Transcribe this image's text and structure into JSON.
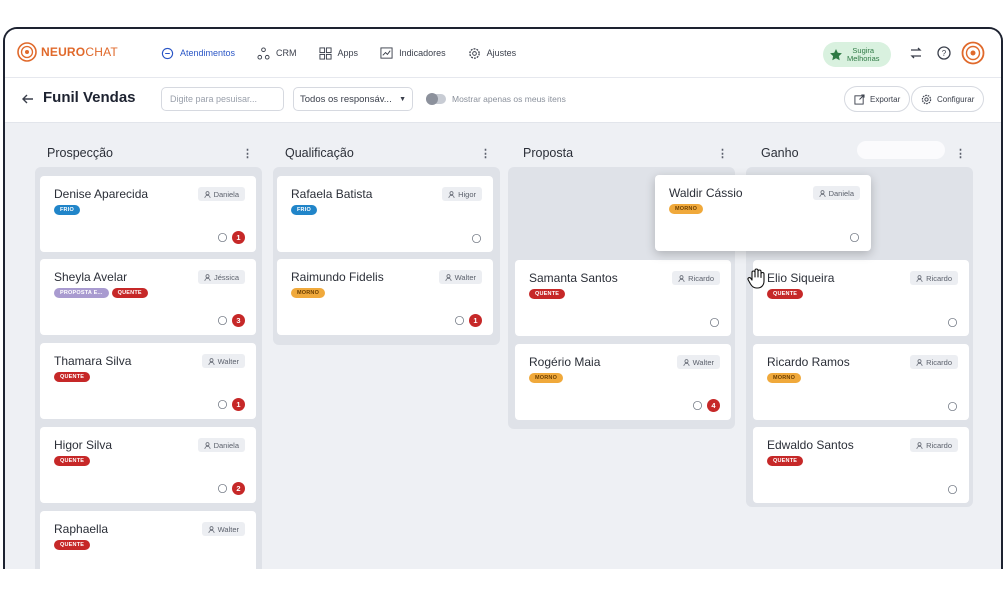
{
  "app": {
    "logo_text": "NEUROCHAT",
    "logo_bold": "NEURO",
    "logo_light": "CHAT"
  },
  "nav": {
    "items": [
      {
        "label": "Atendimentos",
        "icon": "chat-bubble-icon",
        "active": true
      },
      {
        "label": "CRM",
        "icon": "hierarchy-icon",
        "active": false
      },
      {
        "label": "Apps",
        "icon": "grid-icon",
        "active": false
      },
      {
        "label": "Indicadores",
        "icon": "chart-icon",
        "active": false
      },
      {
        "label": "Ajustes",
        "icon": "gear-icon",
        "active": false
      }
    ],
    "suggest_line1": "Sugira",
    "suggest_line2": "Melhorias"
  },
  "header": {
    "title": "Funil Vendas",
    "search_placeholder": "Digite para pesuisar...",
    "responsible_select": "Todos os responsáv...",
    "toggle_label": "Mostrar apenas os meus itens",
    "export_label": "Exportar",
    "config_label": "Configurar"
  },
  "columns": [
    {
      "title": "Prospecção",
      "cards": [
        {
          "name": "Denise Aparecida",
          "owner": "Daniela",
          "tags": [
            {
              "label": "FRIO",
              "kind": "frio"
            }
          ],
          "messages": "1"
        },
        {
          "name": "Sheyla Avelar",
          "owner": "Jéssica",
          "tags": [
            {
              "label": "PROPOSTA E...",
              "kind": "proposta"
            },
            {
              "label": "QUENTE",
              "kind": "quente"
            }
          ],
          "messages": "3"
        },
        {
          "name": "Thamara Silva",
          "owner": "Walter",
          "tags": [
            {
              "label": "QUENTE",
              "kind": "quente"
            }
          ],
          "messages": "1"
        },
        {
          "name": "Higor Silva",
          "owner": "Daniela",
          "tags": [
            {
              "label": "QUENTE",
              "kind": "quente"
            }
          ],
          "messages": "2"
        },
        {
          "name": "Raphaella",
          "owner": "Walter",
          "tags": [
            {
              "label": "QUENTE",
              "kind": "quente"
            }
          ],
          "messages": ""
        }
      ]
    },
    {
      "title": "Qualificação",
      "cards": [
        {
          "name": "Rafaela Batista",
          "owner": "Higor",
          "tags": [
            {
              "label": "FRIO",
              "kind": "frio"
            }
          ],
          "messages": ""
        },
        {
          "name": "Raimundo Fidelis",
          "owner": "Walter",
          "tags": [
            {
              "label": "MORNO",
              "kind": "morno"
            }
          ],
          "messages": "1"
        }
      ]
    },
    {
      "title": "Proposta",
      "cards": [
        {
          "name": "Samanta Santos",
          "owner": "Ricardo",
          "tags": [
            {
              "label": "QUENTE",
              "kind": "quente"
            }
          ],
          "messages": ""
        },
        {
          "name": "Rogério Maia",
          "owner": "Walter",
          "tags": [
            {
              "label": "MORNO",
              "kind": "morno"
            }
          ],
          "messages": "4"
        }
      ]
    },
    {
      "title": "Ganho",
      "cards": [
        {
          "name": "Elio Siqueira",
          "owner": "Ricardo",
          "tags": [
            {
              "label": "QUENTE",
              "kind": "quente"
            }
          ],
          "messages": ""
        },
        {
          "name": "Ricardo Ramos",
          "owner": "Ricardo",
          "tags": [
            {
              "label": "MORNO",
              "kind": "morno"
            }
          ],
          "messages": ""
        },
        {
          "name": "Edwaldo Santos",
          "owner": "Ricardo",
          "tags": [
            {
              "label": "QUENTE",
              "kind": "quente"
            }
          ],
          "messages": ""
        }
      ]
    }
  ],
  "dragging_card": {
    "name": "Waldir Cássio",
    "owner": "Daniela",
    "tags": [
      {
        "label": "MORNO",
        "kind": "morno"
      }
    ],
    "messages": ""
  },
  "colors": {
    "accent": "#2a56c6",
    "brand": "#e0692b",
    "quente": "#c62828",
    "frio": "#2185c9",
    "morno": "#f0a93b",
    "suggest_bg": "#d9f1df"
  }
}
